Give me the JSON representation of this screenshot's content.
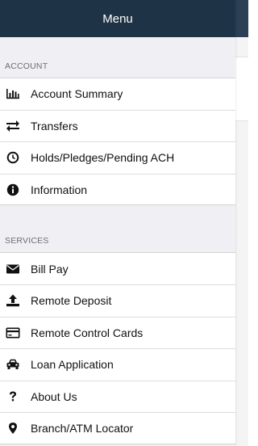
{
  "header": {
    "title": "Menu"
  },
  "sections": [
    {
      "label": "ACCOUNT",
      "items": [
        {
          "label": "Account Summary",
          "icon": "bar-chart-icon"
        },
        {
          "label": "Transfers",
          "icon": "transfer-arrows-icon"
        },
        {
          "label": "Holds/Pledges/Pending ACH",
          "icon": "clock-icon"
        },
        {
          "label": "Information",
          "icon": "info-icon"
        }
      ]
    },
    {
      "label": "SERVICES",
      "items": [
        {
          "label": "Bill Pay",
          "icon": "envelope-icon"
        },
        {
          "label": "Remote Deposit",
          "icon": "upload-icon"
        },
        {
          "label": "Remote Control Cards",
          "icon": "credit-card-icon"
        },
        {
          "label": "Loan Application",
          "icon": "car-icon"
        },
        {
          "label": "About Us",
          "icon": "question-icon"
        },
        {
          "label": "Branch/ATM Locator",
          "icon": "map-pin-icon"
        }
      ]
    }
  ],
  "colors": {
    "header": "#1f3346",
    "background": "#efeff4",
    "text": "#111111",
    "section_label": "#6d6d72"
  }
}
